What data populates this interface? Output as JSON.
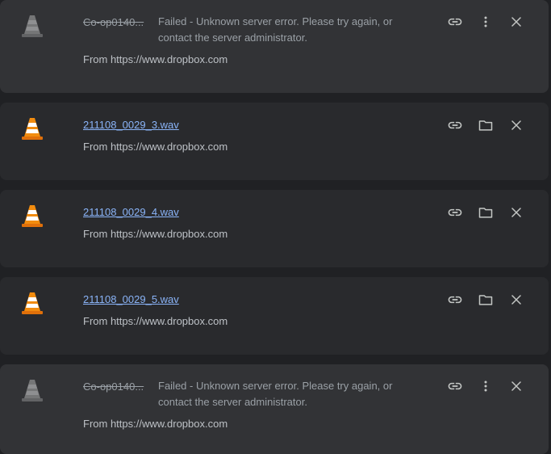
{
  "downloads": [
    {
      "name": "Co-op0140...",
      "status_line1": "Failed - Unknown server error. Please try again, or",
      "status_line2": "contact the server administrator.",
      "source": "From https://www.dropbox.com",
      "state": "failed"
    },
    {
      "name": "211108_0029_3.wav",
      "source": "From https://www.dropbox.com",
      "state": "complete"
    },
    {
      "name": "211108_0029_4.wav",
      "source": "From https://www.dropbox.com",
      "state": "complete"
    },
    {
      "name": "211108_0029_5.wav",
      "source": "From https://www.dropbox.com",
      "state": "complete"
    },
    {
      "name": "Co-op0140...",
      "status_line1": "Failed - Unknown server error. Please try again, or",
      "status_line2": "contact the server administrator.",
      "source": "From https://www.dropbox.com",
      "state": "failed"
    }
  ],
  "icons": {
    "file_type": "vlc-cone-icon",
    "copy_link": "link-icon",
    "show_in_folder": "folder-icon",
    "more": "more-vert-icon",
    "remove": "close-icon"
  },
  "colors": {
    "background": "#202124",
    "card": "#292a2d",
    "card_failed": "#323336",
    "link": "#8ab4f8",
    "muted_text": "#9aa0a6",
    "source_text": "#bdc1c6",
    "cone_orange": "#f28c0f",
    "icon_gray": "#c4c7c5"
  }
}
